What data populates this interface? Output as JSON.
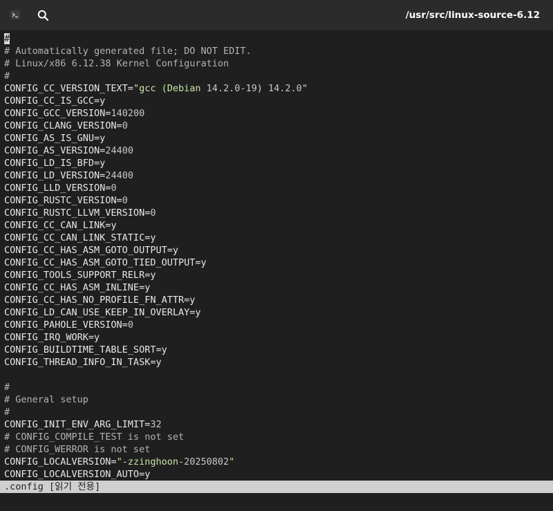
{
  "titlebar": {
    "title": "/usr/src/linux-source-6.12",
    "terminal_icon": "terminal-icon",
    "search_icon": "search-icon"
  },
  "colors": {
    "background": "#1f1f1f",
    "titlebar": "#2b2b2b",
    "text": "#e8e8e8",
    "comment": "#b4b4b4",
    "number": "#c8c8c8",
    "string": "#c7e6a8",
    "statusbar": "#cfcfcf"
  },
  "editor": {
    "cursor_char": "#",
    "lines": [
      "#",
      "# Automatically generated file; DO NOT EDIT.",
      "# Linux/x86 6.12.38 Kernel Configuration",
      "#",
      "CONFIG_CC_VERSION_TEXT=\"gcc (Debian 14.2.0-19) 14.2.0\"",
      "CONFIG_CC_IS_GCC=y",
      "CONFIG_GCC_VERSION=140200",
      "CONFIG_CLANG_VERSION=0",
      "CONFIG_AS_IS_GNU=y",
      "CONFIG_AS_VERSION=24400",
      "CONFIG_LD_IS_BFD=y",
      "CONFIG_LD_VERSION=24400",
      "CONFIG_LLD_VERSION=0",
      "CONFIG_RUSTC_VERSION=0",
      "CONFIG_RUSTC_LLVM_VERSION=0",
      "CONFIG_CC_CAN_LINK=y",
      "CONFIG_CC_CAN_LINK_STATIC=y",
      "CONFIG_CC_HAS_ASM_GOTO_OUTPUT=y",
      "CONFIG_CC_HAS_ASM_GOTO_TIED_OUTPUT=y",
      "CONFIG_TOOLS_SUPPORT_RELR=y",
      "CONFIG_CC_HAS_ASM_INLINE=y",
      "CONFIG_CC_HAS_NO_PROFILE_FN_ATTR=y",
      "CONFIG_LD_CAN_USE_KEEP_IN_OVERLAY=y",
      "CONFIG_PAHOLE_VERSION=0",
      "CONFIG_IRQ_WORK=y",
      "CONFIG_BUILDTIME_TABLE_SORT=y",
      "CONFIG_THREAD_INFO_IN_TASK=y",
      "",
      "#",
      "# General setup",
      "#",
      "CONFIG_INIT_ENV_ARG_LIMIT=32",
      "# CONFIG_COMPILE_TEST is not set",
      "# CONFIG_WERROR is not set",
      "CONFIG_LOCALVERSION=\"-zzinghoon-20250802\"",
      "CONFIG_LOCALVERSION_AUTO=y"
    ]
  },
  "statusbar": {
    "text": ".config [읽기 전용]"
  }
}
